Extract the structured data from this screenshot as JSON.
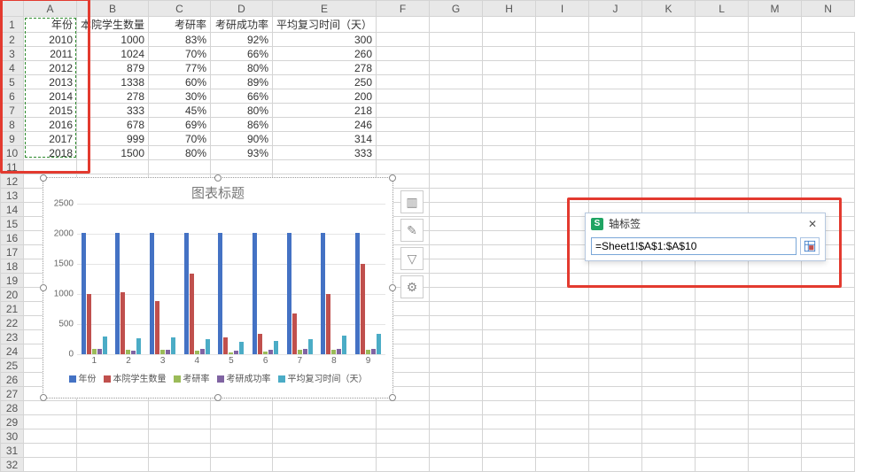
{
  "columns": [
    "A",
    "B",
    "C",
    "D",
    "E",
    "F",
    "G",
    "H",
    "I",
    "J",
    "K",
    "L",
    "M",
    "N"
  ],
  "row_numbers": [
    1,
    2,
    3,
    4,
    5,
    6,
    7,
    8,
    9,
    10,
    11,
    12,
    13,
    14,
    15,
    16,
    17,
    18,
    19,
    20,
    21,
    22,
    23,
    24,
    25,
    26,
    27,
    28,
    29,
    30,
    31,
    32
  ],
  "headers": {
    "A": "年份",
    "B": "本院学生数量",
    "C": "考研率",
    "D": "考研成功率",
    "E": "平均复习时间（天）"
  },
  "rows": [
    {
      "A": "2010",
      "B": "1000",
      "C": "83%",
      "D": "92%",
      "E": "300"
    },
    {
      "A": "2011",
      "B": "1024",
      "C": "70%",
      "D": "66%",
      "E": "260"
    },
    {
      "A": "2012",
      "B": "879",
      "C": "77%",
      "D": "80%",
      "E": "278"
    },
    {
      "A": "2013",
      "B": "1338",
      "C": "60%",
      "D": "89%",
      "E": "250"
    },
    {
      "A": "2014",
      "B": "278",
      "C": "30%",
      "D": "66%",
      "E": "200"
    },
    {
      "A": "2015",
      "B": "333",
      "C": "45%",
      "D": "80%",
      "E": "218"
    },
    {
      "A": "2016",
      "B": "678",
      "C": "69%",
      "D": "86%",
      "E": "246"
    },
    {
      "A": "2017",
      "B": "999",
      "C": "70%",
      "D": "90%",
      "E": "314"
    },
    {
      "A": "2018",
      "B": "1500",
      "C": "80%",
      "D": "93%",
      "E": "333"
    }
  ],
  "chart": {
    "title": "图表标题",
    "x_categories": [
      "1",
      "2",
      "3",
      "4",
      "5",
      "6",
      "7",
      "8",
      "9"
    ],
    "legend": [
      "年份",
      "本院学生数量",
      "考研率",
      "考研成功率",
      "平均复习时间（天）"
    ]
  },
  "dialog": {
    "title": "轴标签",
    "value": "=Sheet1!$A$1:$A$10",
    "app_letter": "S"
  },
  "chart_data": {
    "type": "bar",
    "categories": [
      "1",
      "2",
      "3",
      "4",
      "5",
      "6",
      "7",
      "8",
      "9"
    ],
    "series": [
      {
        "name": "年份",
        "values": [
          2010,
          2011,
          2012,
          2013,
          2014,
          2015,
          2016,
          2017,
          2018
        ]
      },
      {
        "name": "本院学生数量",
        "values": [
          1000,
          1024,
          879,
          1338,
          278,
          333,
          678,
          999,
          1500
        ]
      },
      {
        "name": "考研率",
        "values": [
          83,
          70,
          77,
          60,
          30,
          45,
          69,
          70,
          80
        ]
      },
      {
        "name": "考研成功率",
        "values": [
          92,
          66,
          80,
          89,
          66,
          80,
          86,
          90,
          93
        ]
      },
      {
        "name": "平均复习时间（天）",
        "values": [
          300,
          260,
          278,
          250,
          200,
          218,
          246,
          314,
          333
        ]
      }
    ],
    "title": "图表标题",
    "xlabel": "",
    "ylabel": "",
    "ylim": [
      0,
      2500
    ],
    "yticks": [
      0,
      500,
      1000,
      1500,
      2000,
      2500
    ]
  }
}
